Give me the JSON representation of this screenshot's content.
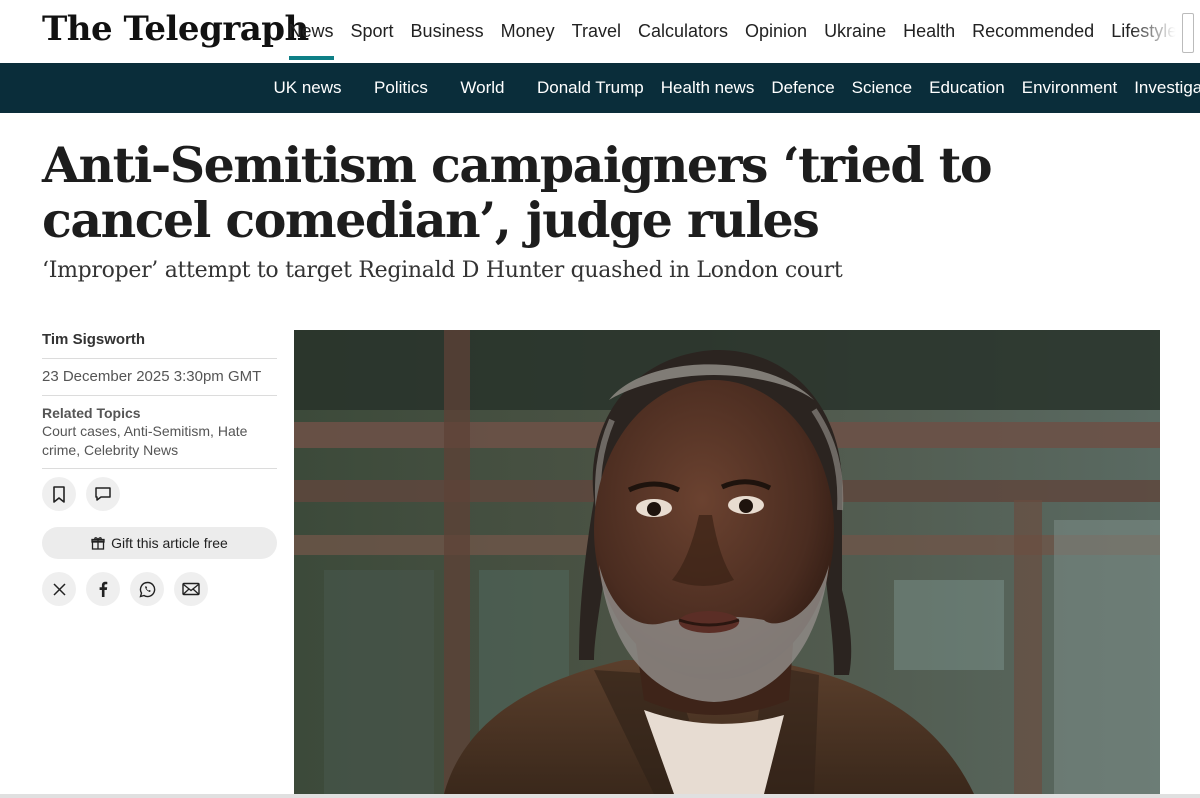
{
  "brand": {
    "name": "The Telegraph"
  },
  "main_nav": [
    {
      "label": "News",
      "active": true
    },
    {
      "label": "Sport"
    },
    {
      "label": "Business"
    },
    {
      "label": "Money"
    },
    {
      "label": "Travel"
    },
    {
      "label": "Calculators"
    },
    {
      "label": "Opinion"
    },
    {
      "label": "Ukraine"
    },
    {
      "label": "Health"
    },
    {
      "label": "Recommended"
    },
    {
      "label": "Lifestyle"
    }
  ],
  "section_nav": [
    {
      "label": "UK news"
    },
    {
      "label": "Politics"
    },
    {
      "label": "World"
    },
    {
      "label": "Donald Trump"
    },
    {
      "label": "Health news"
    },
    {
      "label": "Defence"
    },
    {
      "label": "Science"
    },
    {
      "label": "Education"
    },
    {
      "label": "Environment"
    },
    {
      "label": "Investigations"
    }
  ],
  "article": {
    "headline": "Anti-Semitism campaigners ‘tried to cancel comedian’, judge rules",
    "standfirst": "‘Improper’ attempt to target Reginald D Hunter quashed in London court",
    "author": "Tim Sigsworth",
    "date": "23 December 2025 3:30pm GMT",
    "related_title": "Related Topics",
    "related_topics": "Court cases, Anti-Semitism, Hate crime, Celebrity News",
    "gift_label": "Gift this article free",
    "image_alt": "Reginald D Hunter outside court"
  },
  "colors": {
    "accent": "#0e7f86",
    "section_nav_bg": "#0a2d3a"
  },
  "icons": {
    "save": "bookmark-icon",
    "comment": "comment-icon",
    "gift": "gift-icon",
    "share": [
      "x-icon",
      "facebook-icon",
      "whatsapp-icon",
      "email-icon"
    ]
  }
}
